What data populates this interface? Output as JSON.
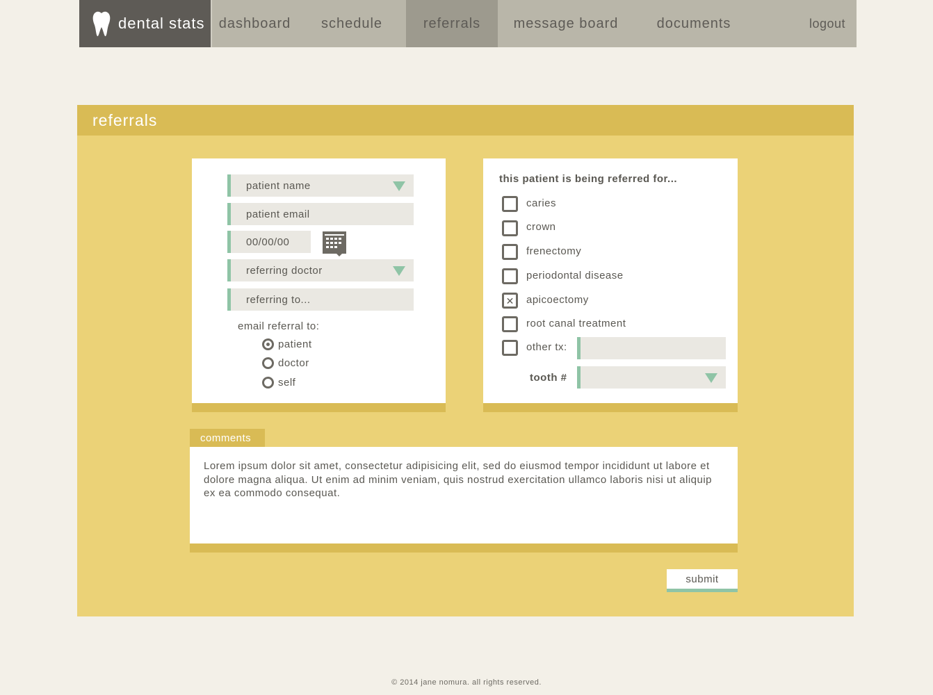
{
  "brand": {
    "name": "dental stats",
    "logo_icon": "tooth-icon"
  },
  "nav": {
    "items": [
      {
        "label": "dashboard"
      },
      {
        "label": "schedule"
      },
      {
        "label": "referrals"
      },
      {
        "label": "message board"
      },
      {
        "label": "documents"
      }
    ],
    "active": "referrals",
    "logout": "logout"
  },
  "panel": {
    "title": "referrals"
  },
  "form": {
    "patient_name": "patient name",
    "patient_email": "patient email",
    "date": "00/00/00",
    "referring_doctor": "referring doctor",
    "referring_to": "referring to...",
    "email_referral_label": "email referral to:",
    "email_options": [
      {
        "label": "patient",
        "selected": true
      },
      {
        "label": "doctor",
        "selected": false
      },
      {
        "label": "self",
        "selected": false
      }
    ]
  },
  "referral_reasons": {
    "heading": "this patient is being referred for...",
    "options": [
      {
        "label": "caries",
        "checked": false
      },
      {
        "label": "crown",
        "checked": false
      },
      {
        "label": "frenectomy",
        "checked": false
      },
      {
        "label": "periodontal disease",
        "checked": false
      },
      {
        "label": "apicoectomy",
        "checked": true
      },
      {
        "label": "root canal treatment",
        "checked": false
      },
      {
        "label": "other tx:",
        "checked": false
      }
    ],
    "other_value": "",
    "tooth_label": "tooth #",
    "tooth_value": ""
  },
  "comments": {
    "label": "comments",
    "text": "Lorem ipsum dolor sit amet, consectetur adipisicing elit, sed do eiusmod tempor incididunt ut labore et dolore magna aliqua. Ut enim ad minim veniam, quis nostrud exercitation ullamco laboris nisi ut aliquip ex ea commodo consequat."
  },
  "submit_label": "submit",
  "footer": "© 2014 jane nomura. all rights reserved.",
  "colors": {
    "accent_green": "#8fc4a6",
    "panel_yellow": "#ebd277",
    "header_gold": "#d9bb55",
    "nav_gray": "#b9b6a9",
    "brand_dark": "#5e5b56"
  }
}
